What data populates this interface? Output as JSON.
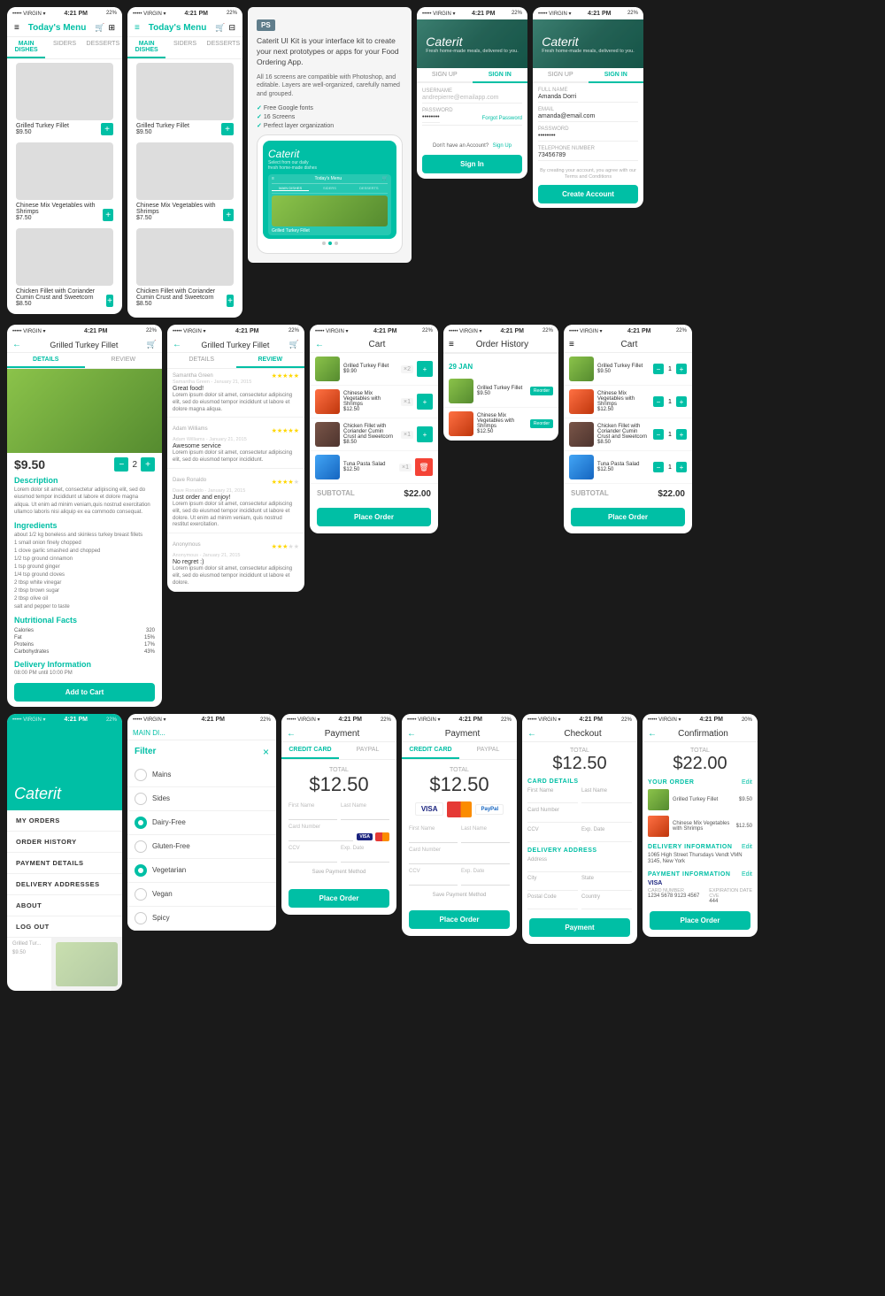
{
  "app": {
    "name": "Caterit",
    "tagline": "Fresh home-made meals, delivered to you.",
    "logo_text": "Caterit"
  },
  "promo": {
    "ps_badge": "PS",
    "title": "Caterit UI Kit is your interface kit to create your next prototypes or apps for your Food Ordering App.",
    "subtitle": "All 16 screens are compatible with Photoshop, and editable. Layers are well-organized, carefully named and grouped.",
    "features": [
      "Free Google fonts",
      "16 Screens",
      "Perfect layer organization"
    ]
  },
  "menu": {
    "title": "Today's Menu",
    "tabs": [
      "MAIN DISHES",
      "SIDERS",
      "DESSERTS"
    ],
    "items": [
      {
        "name": "Grilled Turkey Fillet",
        "price": "$9.50",
        "color": "food-grilled"
      },
      {
        "name": "Chinese Mix Vegetables with Shrimps",
        "price": "$7.50",
        "color": "food-chinese"
      },
      {
        "name": "Chicken Fillet with Coriander Cumin Crust and Sweetcorn",
        "price": "$8.50",
        "color": "food-chicken"
      }
    ]
  },
  "auth": {
    "signin_tab": "SIGN IN",
    "signup_tab": "SIGN UP",
    "fields": {
      "username_placeholder": "andrepierre@emailapp.com",
      "password_dots": "••••••••",
      "forgot_password": "Forgot Password",
      "no_account": "Don't have an Account?",
      "sign_up_link": "Sign Up"
    },
    "register_fields": {
      "full_name_label": "FULL NAME",
      "full_name": "Amanda Dorri",
      "email_label": "EMAIL",
      "email": "amanda@email.com",
      "password_label": "PASSWORD",
      "password": "••••••••",
      "phone_label": "TELEPHONE NUMBER",
      "phone": "73456789",
      "terms": "By creating your account, you agree with our Terms and Conditions"
    },
    "buttons": {
      "sign_in": "Sign In",
      "create_account": "Create Account"
    }
  },
  "detail": {
    "title": "Grilled Turkey Fillet",
    "tabs": [
      "DETAILS",
      "REVIEW"
    ],
    "price": "$9.50",
    "description_title": "Description",
    "description": "Lorem dolor sit amet, consectetur adipiscing elit, sed do eiusmod tempor incididunt ut labore et dolore magna aliqua. Ut enim ad minim veniam,quis nostrud exercitation ullamco laboris nisi aliquip ex ea commodo consequat.",
    "ingredients_title": "Ingredients",
    "ingredients": "about 1/2 kg boneless and skinless turkey breast fillets\n1 small onion finely chopped\n1 clove garlic smashed and chopped\n1/2 tsp ground cinnamon\n1 tsp ground ginger\n1/4 tsp ground cloves\n2 tbsp white vinegar\n2 tbsp brown sugar\n2 tbsp olive oil\nsalt and pepper to taste",
    "nutrition_title": "Nutritional Facts",
    "nutrition": [
      {
        "label": "Calories",
        "value": "320"
      },
      {
        "label": "Fat",
        "value": "15%"
      },
      {
        "label": "Proteins",
        "value": "17%"
      },
      {
        "label": "Carbohydrates",
        "value": "43%"
      }
    ],
    "delivery_title": "Delivery Information",
    "delivery": "08:00 PM until 10:00 PM",
    "add_to_cart": "Add to Cart",
    "qty": 2
  },
  "reviews": [
    {
      "author": "Samantha Green",
      "date": "January 21, 2015",
      "stars": 5,
      "title": "Great food!",
      "text": "Lorem ipsum dolor sit amet, consectetur adipiscing elit, sed do eiusmod tempor incididunt ut labore et dolore magna aliqua."
    },
    {
      "author": "Adam Williams",
      "date": "January 21, 2015",
      "stars": 5,
      "title": "Awesome service",
      "text": "Lorem ipsum dolor sit amet, consectetur adipiscing elit, sed do eiusmod tempor incididunt."
    },
    {
      "author": "Dave Ronaldo",
      "date": "January 21, 2015",
      "stars": 4,
      "title": "Just order and enjoy!",
      "text": "Lorem ipsum dolor sit amet, consectetur adipiscing elit, sed do eiusmod tempor incididunt ut labore et dolore. Ut enim ad minim veniam, quis nostrud restitut exercitation ullamco laboris nisi ut aliqua ex ea commodo consequat."
    },
    {
      "author": "Anonymous",
      "date": "January 21, 2015",
      "stars": 3,
      "title": "No regret :)",
      "text": "Lorem ipsum dolor sit amet, consectetur adipiscing elit, sed do eiusmod tempor incididunt ut labore et dolore."
    }
  ],
  "cart": {
    "title": "Cart",
    "items": [
      {
        "name": "Grilled Turkey Fillet",
        "price": "$9.50",
        "qty": 1,
        "color": "food-grilled"
      },
      {
        "name": "Chinese Mix Vegetables with Shrimps",
        "price": "$12.50",
        "qty": 1,
        "color": "food-chinese"
      },
      {
        "name": "Chicken Fillet with Coriander Cumin Crust and Sweetcorn",
        "price": "$8.50",
        "qty": 1,
        "color": "food-chicken"
      },
      {
        "name": "Tuna Pasta Salad",
        "price": "$12.50",
        "qty": 1,
        "color": "food-tuna",
        "delete": true
      }
    ],
    "subtotal_label": "SUBTOTAL",
    "subtotal": "$22.00",
    "place_order": "Place Order"
  },
  "sidebar": {
    "menu_items": [
      "MY ORDERS",
      "ORDER HISTORY",
      "PAYMENT DETAILS",
      "DELIVERY ADDRESSES",
      "ABOUT",
      "LOG OUT"
    ]
  },
  "filter": {
    "title": "Filter",
    "options": [
      {
        "label": "Mains",
        "checked": false
      },
      {
        "label": "Sides",
        "checked": false
      },
      {
        "label": "Dairy-Free",
        "checked": true
      },
      {
        "label": "Gluten-Free",
        "checked": false
      },
      {
        "label": "Vegetarian",
        "checked": true
      },
      {
        "label": "Vegan",
        "checked": false
      },
      {
        "label": "Spicy",
        "checked": false
      }
    ]
  },
  "payment": {
    "title": "Payment",
    "tabs": [
      "CREDIT CARD",
      "PAYPAL"
    ],
    "total_label": "TOTAL",
    "total_alt": "$12.50",
    "total": "$12.50",
    "logos": [
      "VISA",
      "MC",
      "PayPal"
    ],
    "fields": {
      "first_name": "First Name",
      "last_name": "Last Name",
      "card_number": "Card Number",
      "ccv": "CCV",
      "exp_date": "Exp. Date"
    },
    "save_method": "Save Payment Method",
    "place_order": "Place Order"
  },
  "order_history": {
    "title": "Order History",
    "date_label": "29 JAN",
    "items": [
      {
        "name": "Grilled Turkey Fillet",
        "price": "$9.50",
        "color": "food-grilled"
      },
      {
        "name": "Chinese Mix Vegetables with Shrimps",
        "price": "$12.50",
        "color": "food-chinese"
      }
    ],
    "reorder": "Reorder"
  },
  "checkout": {
    "title": "Checkout",
    "total_label": "TOTAL",
    "total": "$12.50",
    "card_details": "CARD DETAILS",
    "delivery_address": "DELIVERY ADDRESS",
    "fields": {
      "first_name": "First Name",
      "last_name": "Last Name",
      "card_number": "Card Number",
      "ccv": "CCV",
      "exp_date": "Exp. Date",
      "address": "Address",
      "city": "City",
      "state": "State",
      "postal_code": "Postal Code",
      "country": "Country"
    },
    "payment_button": "Payment"
  },
  "confirmation": {
    "title": "Confirmation",
    "total_label": "TOTAL",
    "total": "$22.00",
    "your_order": "YOUR ORDER",
    "edit": "Edit",
    "items": [
      {
        "name": "Grilled Turkey Fillet",
        "price": "$9.50",
        "color": "food-grilled"
      },
      {
        "name": "Chinese Mix Vegetables with Shrimps",
        "price": "$12.50",
        "color": "food-chinese"
      }
    ],
    "delivery_info": "DELIVERY INFORMATION",
    "delivery_address": "1065 High Street Thursdays Vendt VMN 3145, New York",
    "payment_info": "PAYMENT INFORMATION",
    "visa_label": "VISA",
    "card_number": "1234 5678 9123 4567",
    "expiration": "444",
    "place_order": "Place Order"
  },
  "status_bar": {
    "carrier": "••••• VIRGIN ▾",
    "time": "4:21 PM",
    "battery": "22%"
  }
}
